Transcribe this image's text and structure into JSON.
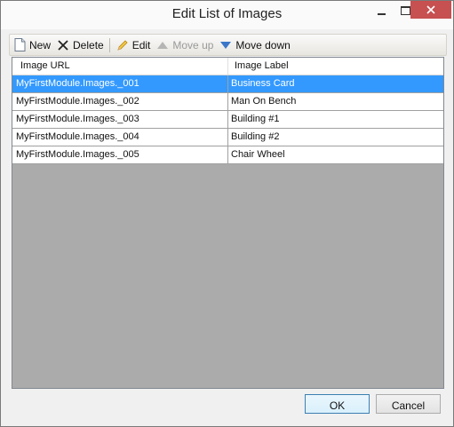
{
  "window": {
    "title": "Edit List of Images"
  },
  "toolbar": {
    "new_label": "New",
    "delete_label": "Delete",
    "edit_label": "Edit",
    "move_up_label": "Move up",
    "move_down_label": "Move down"
  },
  "grid": {
    "columns": [
      "Image URL",
      "Image Label"
    ],
    "rows": [
      [
        "MyFirstModule.Images._001",
        "Business Card"
      ],
      [
        "MyFirstModule.Images._002",
        "Man On Bench"
      ],
      [
        "MyFirstModule.Images._003",
        "Building #1"
      ],
      [
        "MyFirstModule.Images._004",
        "Building #2"
      ],
      [
        "MyFirstModule.Images._005",
        "Chair Wheel"
      ]
    ],
    "selected_row": 0
  },
  "buttons": {
    "ok": "OK",
    "cancel": "Cancel"
  },
  "colors": {
    "selection": "#3399ff",
    "close_button": "#c75050",
    "grid_background": "#ababab"
  }
}
